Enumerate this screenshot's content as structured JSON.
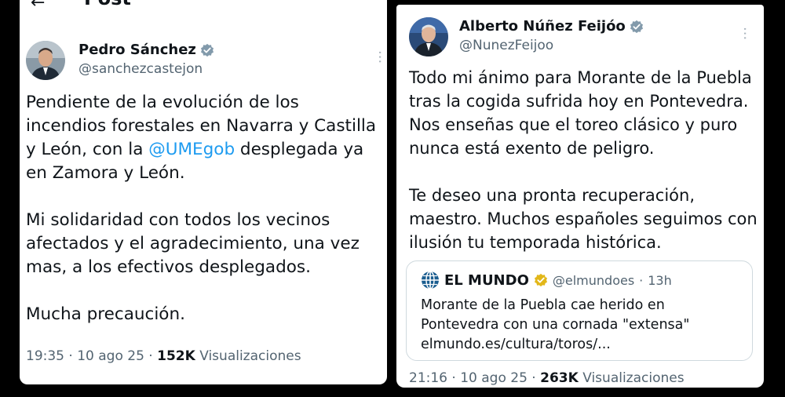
{
  "left_tweet": {
    "header_title": "Post",
    "author_name": "Pedro Sánchez",
    "author_handle": "@sanchezcastejon",
    "text_before_mention": "Pendiente de la evolución de los incendios forestales en Navarra y Castilla y León, con la ",
    "mention": "@UMEgob",
    "text_after_mention": " desplegada ya en Zamora y León.\n\nMi solidaridad con todos los vecinos afectados y el agradecimiento, una vez mas, a los efectivos desplegados.\n\nMucha precaución.",
    "time": "19:35",
    "date": "10 ago 25",
    "views_count": "152K",
    "views_label": "Visualizaciones"
  },
  "right_tweet": {
    "author_name": "Alberto Núñez Feijóo",
    "author_handle": "@NunezFeijoo",
    "text": "Todo mi ánimo para Morante de la Puebla tras la cogida sufrida hoy en Pontevedra. Nos enseñas que el toreo clásico y puro nunca está exento de peligro.\n\nTe deseo una pronta recuperación, maestro. Muchos españoles seguimos con ilusión tu temporada histórica.",
    "quote": {
      "source_name": "EL MUNDO",
      "source_handle": "@elmundoes",
      "age": "13h",
      "text": "Morante de la Puebla cae herido en Pontevedra con una cornada \"extensa\" elmundo.es/cultura/toros/..."
    },
    "time": "21:16",
    "date": "10 ago 25",
    "views_count": "263K",
    "views_label": "Visualizaciones"
  },
  "colors": {
    "verified_badge": "#829aab",
    "quote_badge": "#e2b719",
    "link": "#1d9bf0",
    "secondary_text": "#536471",
    "mundo_blue": "#1a5d8f"
  },
  "icons": [
    "back-arrow-icon",
    "verified-badge-icon",
    "more-options-icon",
    "el-mundo-logo-icon"
  ]
}
